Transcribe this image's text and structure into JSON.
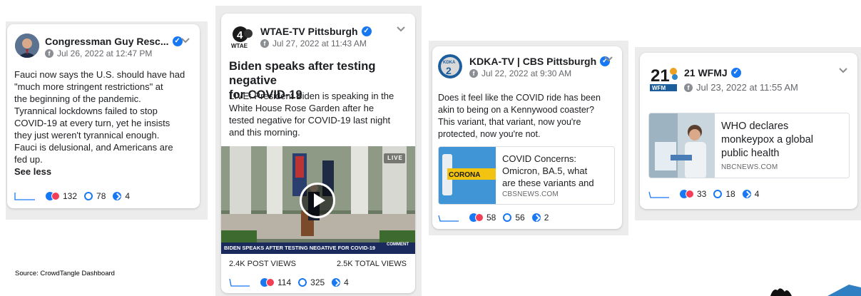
{
  "source_note": "Source: CrowdTangle Dashboard",
  "cards": [
    {
      "page": "Congressman Guy Resc...",
      "date": "Jul 26, 2022 at 12:47 PM",
      "text_lines": [
        "Fauci now says the U.S. should have had",
        "\"much more stringent restrictions\" at",
        "the beginning of the pandemic.",
        "Tyrannical lockdowns failed to stop",
        "COVID-19 at every turn, yet he insists",
        "they just weren't tyrannical enough.",
        "Fauci is delusional, and Americans are",
        "fed up."
      ],
      "see_less": "See less",
      "reactions": "132",
      "comments": "78",
      "shares": "4"
    },
    {
      "page": "WTAE-TV Pittsburgh",
      "date": "Jul 27, 2022 at 11:43 AM",
      "logo_text": "WTAE",
      "logo_number": "4",
      "headline_lines": [
        "Biden speaks after testing negative",
        "for COVID-19"
      ],
      "text_lines": [
        "LIVE: President Biden is speaking in the",
        "White House Rose Garden after he",
        "tested negative for COVID-19 last night",
        "and this morning."
      ],
      "live_badge": "LIVE",
      "video_caption": "BIDEN SPEAKS AFTER TESTING NEGATIVE FOR COVID-19",
      "video_comment": "COMMENT",
      "post_views": "2.4K POST VIEWS",
      "total_views": "2.5K TOTAL VIEWS",
      "reactions": "114",
      "comments": "325",
      "shares": "4"
    },
    {
      "page": "KDKA-TV | CBS Pittsburgh",
      "date": "Jul 22, 2022 at 9:30 AM",
      "logo_text": "KDKA",
      "logo_number": "2",
      "text_lines": [
        "Does it feel like the COVID ride has been",
        "akin to being on a Kennywood coaster?",
        "This variant, that variant, now you're",
        "protected, now you're not."
      ],
      "link_title_lines": [
        "COVID Concerns:",
        "Omicron, BA.5, what",
        "are these variants and"
      ],
      "link_source": "CBSNEWS.COM",
      "thumb_text": "CORONA",
      "reactions": "58",
      "comments": "56",
      "shares": "2"
    },
    {
      "page": "21 WFMJ",
      "date": "Jul 23, 2022 at 11:55 AM",
      "logo_number": "21",
      "logo_text": "WFM",
      "link_title_lines": [
        "WHO declares",
        "monkeypox a global",
        "public health"
      ],
      "link_source": "NBCNEWS.COM",
      "reactions": "33",
      "comments": "18",
      "shares": "4"
    }
  ],
  "colors": {
    "accent": "#1877f2",
    "love": "#f33e58",
    "panel_bg": "#ececec",
    "secondary_text": "#65676b",
    "video_caption_bg": "#1b2a5c"
  }
}
